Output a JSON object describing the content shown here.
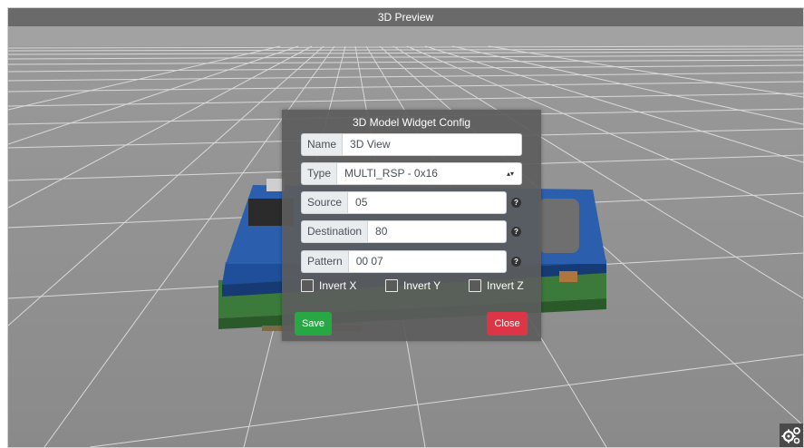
{
  "panel": {
    "title": "3D Preview"
  },
  "dialog": {
    "title": "3D Model Widget Config",
    "fields": {
      "name": {
        "label": "Name",
        "value": "3D View"
      },
      "type": {
        "label": "Type",
        "value": "MULTI_RSP - 0x16"
      },
      "source": {
        "label": "Source",
        "value": "05"
      },
      "destination": {
        "label": "Destination",
        "value": "80"
      },
      "pattern": {
        "label": "Pattern",
        "value": "00 07"
      }
    },
    "checkboxes": {
      "invert_x": {
        "label": "Invert X",
        "checked": false
      },
      "invert_y": {
        "label": "Invert Y",
        "checked": false
      },
      "invert_z": {
        "label": "Invert Z",
        "checked": false
      }
    },
    "buttons": {
      "save": "Save",
      "close": "Close"
    },
    "help_glyph": "?"
  },
  "icons": {
    "help": "question-circle-icon",
    "settings": "gears-icon",
    "select_arrows": "select-arrows-icon"
  },
  "colors": {
    "save": "#28a745",
    "close": "#dc3545",
    "header": "#6a6a6a",
    "floor": "#8c8c8c"
  }
}
